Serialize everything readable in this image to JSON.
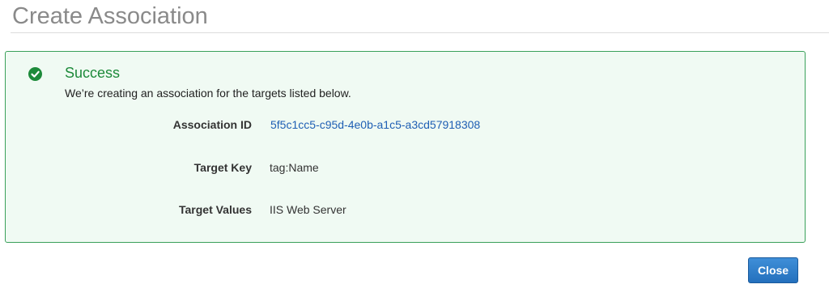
{
  "page": {
    "title": "Create Association"
  },
  "success": {
    "heading": "Success",
    "message": "We’re creating an association for the targets listed below.",
    "icon": "check-circle-icon",
    "color": "#1d8a3a"
  },
  "details": [
    {
      "label": "Association ID",
      "value": "5f5c1cc5-c95d-4e0b-a1c5-a3cd57918308"
    },
    {
      "label": "Target Key",
      "value": "tag:Name"
    },
    {
      "label": "Target Values",
      "value": "IIS Web Server"
    }
  ],
  "actions": {
    "close_label": "Close",
    "accent": "#2470bd"
  }
}
